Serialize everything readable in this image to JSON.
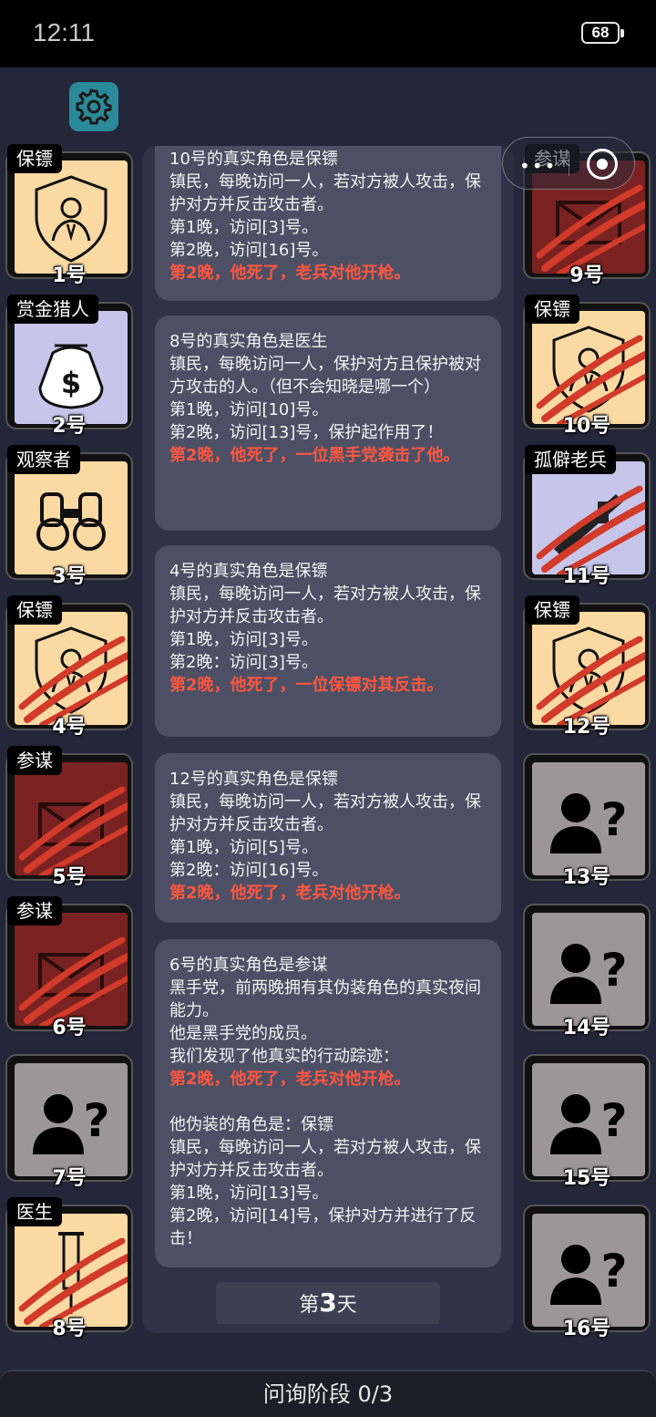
{
  "status_bar": {
    "time": "12:11",
    "battery": "68"
  },
  "capsule": {
    "more": "•••"
  },
  "players_left": [
    {
      "num": "1号",
      "role": "保镖",
      "type": "bodyguard",
      "dead": false
    },
    {
      "num": "2号",
      "role": "赏金猎人",
      "type": "hunter",
      "dead": false
    },
    {
      "num": "3号",
      "role": "观察者",
      "type": "watcher",
      "dead": false
    },
    {
      "num": "4号",
      "role": "保镖",
      "type": "bodyguard",
      "dead": true
    },
    {
      "num": "5号",
      "role": "参谋",
      "type": "consig",
      "dead": true
    },
    {
      "num": "6号",
      "role": "参谋",
      "type": "consig",
      "dead": true
    },
    {
      "num": "7号",
      "role": "",
      "type": "unknown",
      "dead": false
    },
    {
      "num": "8号",
      "role": "医生",
      "type": "doctor",
      "dead": true
    }
  ],
  "players_right": [
    {
      "num": "9号",
      "role": "参谋",
      "type": "consig",
      "dead": true
    },
    {
      "num": "10号",
      "role": "保镖",
      "type": "bodyguard",
      "dead": true
    },
    {
      "num": "11号",
      "role": "孤僻老兵",
      "type": "vet",
      "dead": true
    },
    {
      "num": "12号",
      "role": "保镖",
      "type": "bodyguard",
      "dead": true
    },
    {
      "num": "13号",
      "role": "",
      "type": "unknown",
      "dead": false
    },
    {
      "num": "14号",
      "role": "",
      "type": "unknown",
      "dead": false
    },
    {
      "num": "15号",
      "role": "",
      "type": "unknown",
      "dead": false
    },
    {
      "num": "16号",
      "role": "",
      "type": "unknown",
      "dead": false
    }
  ],
  "messages": [
    {
      "text": "10号的真实角色是保镖\n镇民，每晚访问一人，若对方被人攻击，保护对方并反击攻击者。\n第1晚，访问[3]号。\n第2晚，访问[16]号。",
      "red": "第2晚，他死了，老兵对他开枪。",
      "after": ""
    },
    {
      "text": "8号的真实角色是医生\n镇民，每晚访问一人，保护对方且保护被对方攻击的人。（但不会知晓是哪一个）\n第1晚，访问[10]号。\n第2晚，访问[13]号，保护起作用了！",
      "red": "第2晚，他死了，一位黑手党袭击了他。",
      "after": ""
    },
    {
      "text": "4号的真实角色是保镖\n镇民，每晚访问一人，若对方被人攻击，保护对方并反击攻击者。\n第1晚，访问[3]号。\n第2晚：访问[3]号。",
      "red": "第2晚，他死了，一位保镖对其反击。",
      "after": ""
    },
    {
      "text": "12号的真实角色是保镖\n镇民，每晚访问一人，若对方被人攻击，保护对方并反击攻击者。\n第1晚，访问[5]号。\n第2晚：访问[16]号。",
      "red": "第2晚，他死了，老兵对他开枪。",
      "after": ""
    },
    {
      "text": "6号的真实角色是参谋\n黑手党，前两晚拥有其伪装角色的真实夜间能力。\n他是黑手党的成员。\n我们发现了他真实的行动踪迹：",
      "red": "第2晚，他死了，老兵对他开枪。",
      "after": "\n他伪装的角色是：保镖\n镇民，每晚访问一人，若对方被人攻击，保护对方并反击攻击者。\n第1晚，访问[13]号。\n第2晚，访问[14]号，保护对方并进行了反击！"
    }
  ],
  "day": {
    "prefix": "第",
    "number": "3",
    "suffix": "天"
  },
  "phase": "问询阶段 0/3"
}
